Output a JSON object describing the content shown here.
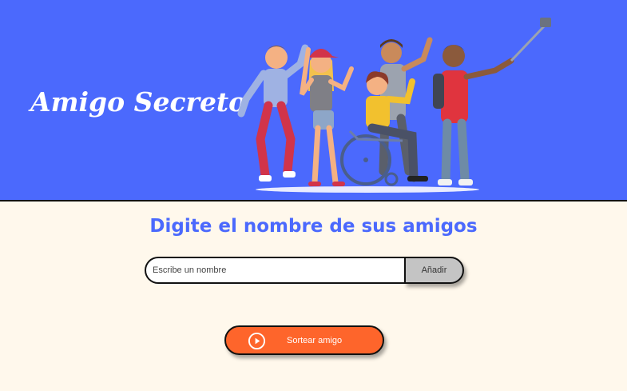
{
  "header": {
    "title": "Amigo Secreto",
    "illustration": "friends-group-selfie-illustration"
  },
  "main": {
    "subtitle": "Digite el nombre de sus amigos",
    "input": {
      "placeholder": "Escribe un nombre",
      "value": ""
    },
    "add_button_label": "Añadir",
    "draw_button_label": "Sortear amigo",
    "draw_button_icon": "play-circle-icon"
  },
  "colors": {
    "header_bg": "#4B69FD",
    "page_bg": "#FFF8EC",
    "accent": "#4B69FD",
    "draw_button": "#FE652B",
    "add_button": "#C4C4C4"
  }
}
